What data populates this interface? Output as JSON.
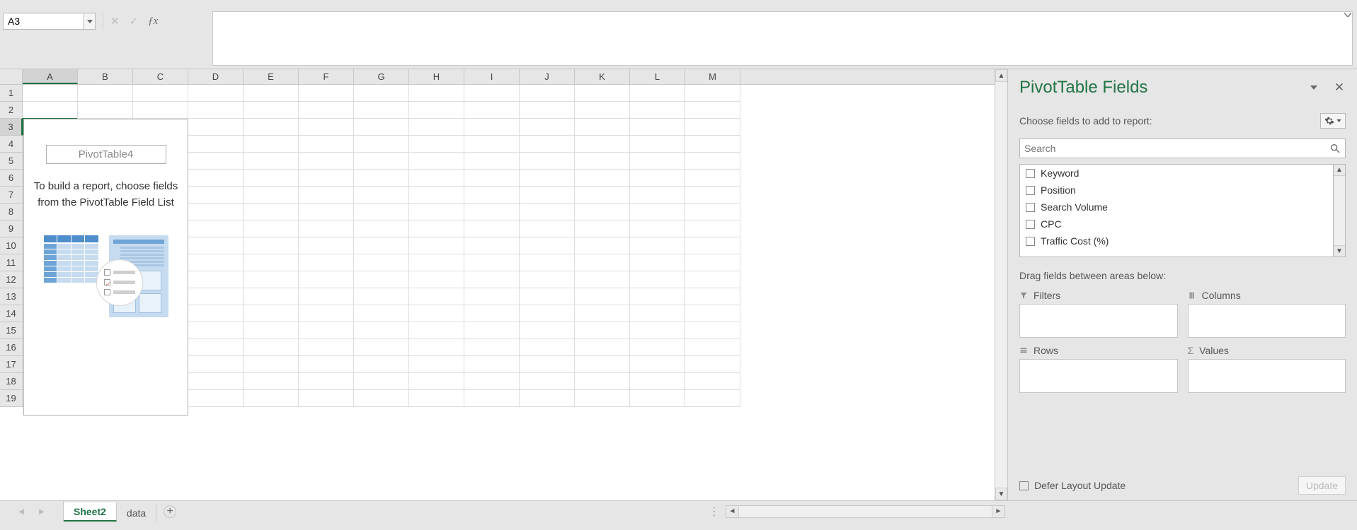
{
  "namebox": {
    "value": "A3"
  },
  "columns": [
    "A",
    "B",
    "C",
    "D",
    "E",
    "F",
    "G",
    "H",
    "I",
    "J",
    "K",
    "L",
    "M"
  ],
  "rows": [
    "1",
    "2",
    "3",
    "4",
    "5",
    "6",
    "7",
    "8",
    "9",
    "10",
    "11",
    "12",
    "13",
    "14",
    "15",
    "16",
    "17",
    "18",
    "19"
  ],
  "active": {
    "col": 0,
    "row": 2
  },
  "pivot_placeholder": {
    "title": "PivotTable4",
    "hint": "To build a report, choose fields from the PivotTable Field List"
  },
  "panel": {
    "title": "PivotTable Fields",
    "subtitle": "Choose fields to add to report:",
    "search_placeholder": "Search",
    "fields": [
      "Keyword",
      "Position",
      "Search Volume",
      "CPC",
      "Traffic Cost (%)"
    ],
    "drag_hint": "Drag fields between areas below:",
    "areas": {
      "filters": "Filters",
      "columns": "Columns",
      "rows": "Rows",
      "values": "Values"
    },
    "defer_label": "Defer Layout Update",
    "update_label": "Update"
  },
  "sheets": {
    "tabs": [
      "Sheet2",
      "data"
    ],
    "active": 0
  }
}
